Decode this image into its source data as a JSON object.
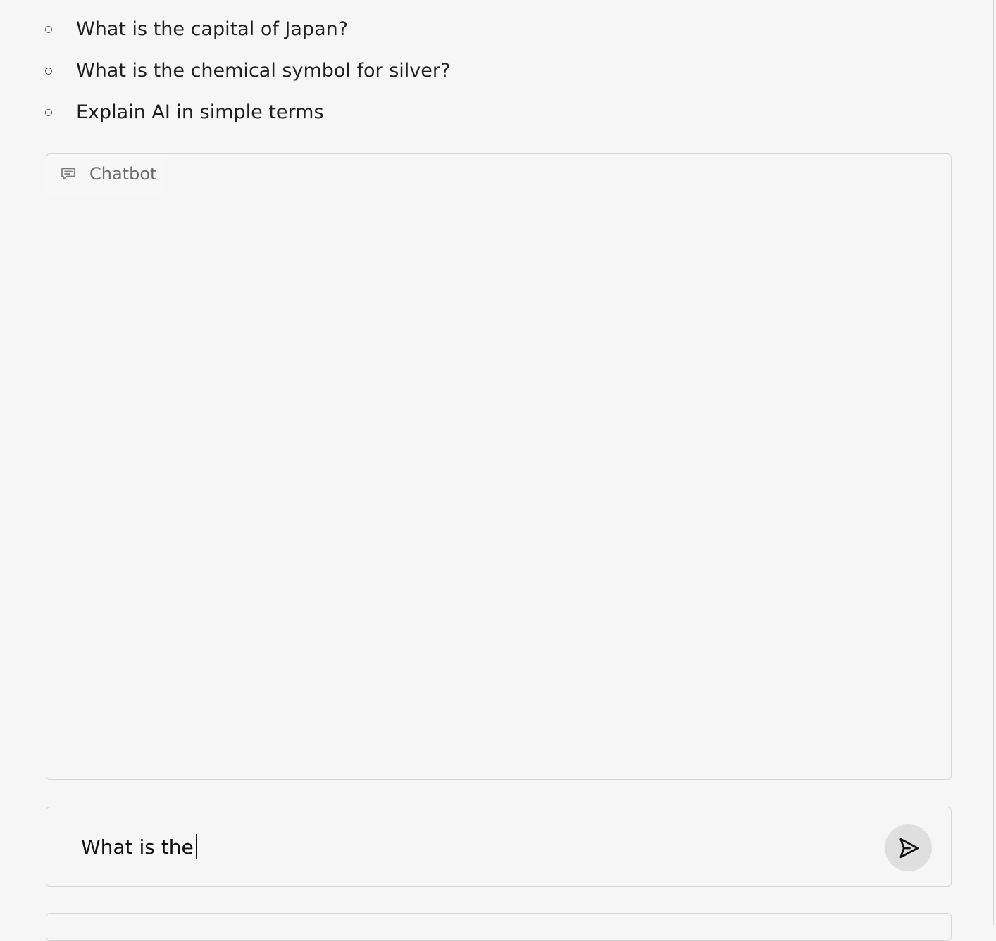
{
  "examples": [
    {
      "label": "What is the capital of Japan?"
    },
    {
      "label": "What is the chemical symbol for silver?"
    },
    {
      "label": "Explain AI in simple terms"
    }
  ],
  "chatbot": {
    "label": "Chatbot",
    "icon": "chat-bubble-icon"
  },
  "input": {
    "value": "What is the"
  },
  "send_button": {
    "icon": "send-icon"
  }
}
